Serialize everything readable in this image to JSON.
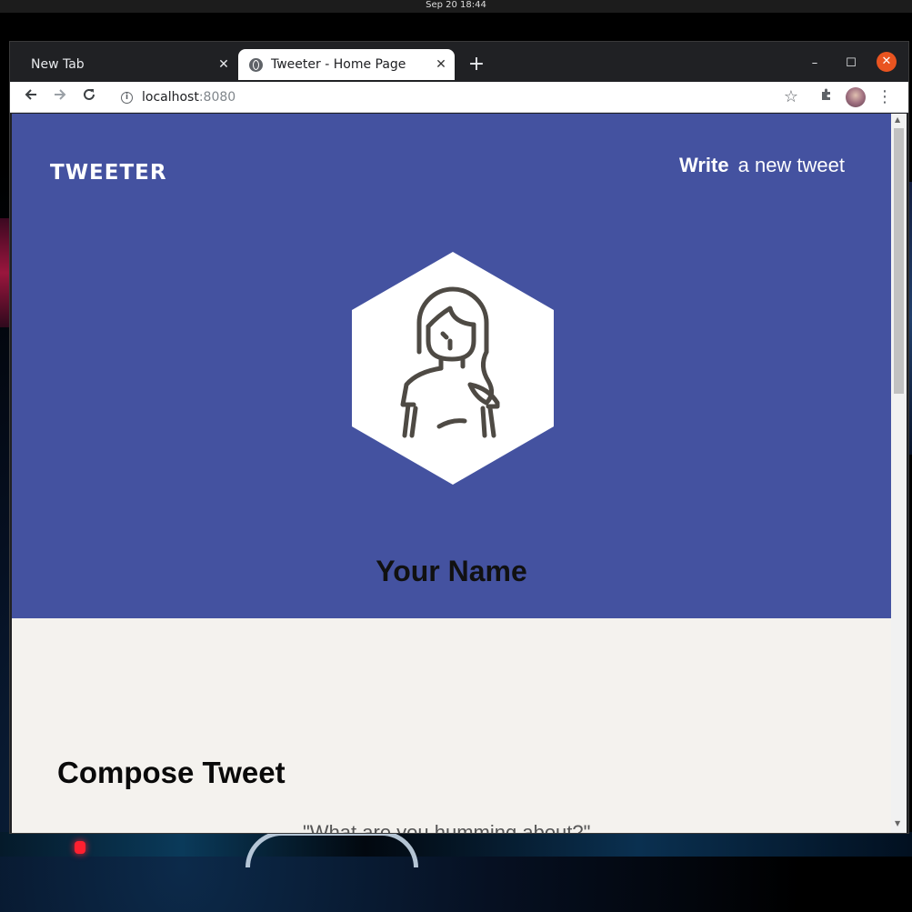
{
  "system": {
    "clock": "Sep 20  18:44"
  },
  "browser": {
    "tabs": [
      {
        "title": "New Tab",
        "active": false
      },
      {
        "title": "Tweeter - Home Page",
        "active": true
      }
    ],
    "new_tab_label": "+",
    "url": {
      "host": "localhost",
      "port": ":8080"
    },
    "icons": {
      "back": "arrow-left-icon",
      "forward": "arrow-right-icon",
      "reload": "reload-icon",
      "info": "info-icon",
      "star": "star-icon",
      "extensions": "puzzle-icon",
      "menu": "dots-vertical-icon"
    }
  },
  "page": {
    "logo": "TWEETER",
    "nav": {
      "write_bold": "Write",
      "write_rest": "a new tweet"
    },
    "profile": {
      "name": "Your Name"
    },
    "compose": {
      "title": "Compose Tweet",
      "placeholder": "\"What are you humming about?\""
    }
  },
  "colors": {
    "hero_bg": "#4452a0",
    "page_bg": "#f4f2ee",
    "avatar_stroke": "#4e4a44"
  }
}
